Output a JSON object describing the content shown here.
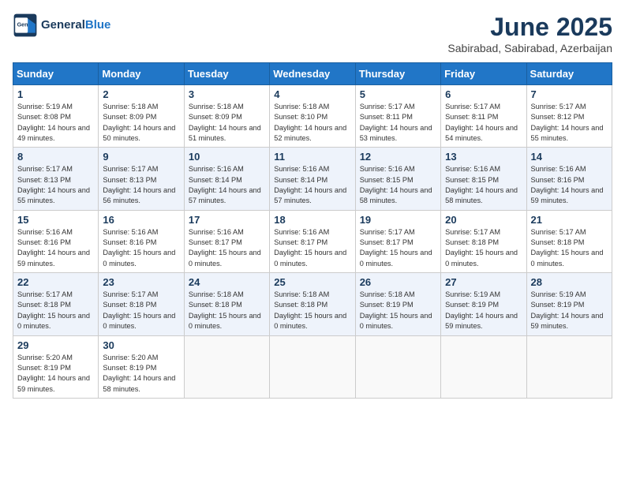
{
  "logo": {
    "line1": "General",
    "line2": "Blue"
  },
  "title": "June 2025",
  "subtitle": "Sabirabad, Sabirabad, Azerbaijan",
  "weekdays": [
    "Sunday",
    "Monday",
    "Tuesday",
    "Wednesday",
    "Thursday",
    "Friday",
    "Saturday"
  ],
  "weeks": [
    [
      {
        "day": "1",
        "sunrise": "Sunrise: 5:19 AM",
        "sunset": "Sunset: 8:08 PM",
        "daylight": "Daylight: 14 hours and 49 minutes."
      },
      {
        "day": "2",
        "sunrise": "Sunrise: 5:18 AM",
        "sunset": "Sunset: 8:09 PM",
        "daylight": "Daylight: 14 hours and 50 minutes."
      },
      {
        "day": "3",
        "sunrise": "Sunrise: 5:18 AM",
        "sunset": "Sunset: 8:09 PM",
        "daylight": "Daylight: 14 hours and 51 minutes."
      },
      {
        "day": "4",
        "sunrise": "Sunrise: 5:18 AM",
        "sunset": "Sunset: 8:10 PM",
        "daylight": "Daylight: 14 hours and 52 minutes."
      },
      {
        "day": "5",
        "sunrise": "Sunrise: 5:17 AM",
        "sunset": "Sunset: 8:11 PM",
        "daylight": "Daylight: 14 hours and 53 minutes."
      },
      {
        "day": "6",
        "sunrise": "Sunrise: 5:17 AM",
        "sunset": "Sunset: 8:11 PM",
        "daylight": "Daylight: 14 hours and 54 minutes."
      },
      {
        "day": "7",
        "sunrise": "Sunrise: 5:17 AM",
        "sunset": "Sunset: 8:12 PM",
        "daylight": "Daylight: 14 hours and 55 minutes."
      }
    ],
    [
      {
        "day": "8",
        "sunrise": "Sunrise: 5:17 AM",
        "sunset": "Sunset: 8:13 PM",
        "daylight": "Daylight: 14 hours and 55 minutes."
      },
      {
        "day": "9",
        "sunrise": "Sunrise: 5:17 AM",
        "sunset": "Sunset: 8:13 PM",
        "daylight": "Daylight: 14 hours and 56 minutes."
      },
      {
        "day": "10",
        "sunrise": "Sunrise: 5:16 AM",
        "sunset": "Sunset: 8:14 PM",
        "daylight": "Daylight: 14 hours and 57 minutes."
      },
      {
        "day": "11",
        "sunrise": "Sunrise: 5:16 AM",
        "sunset": "Sunset: 8:14 PM",
        "daylight": "Daylight: 14 hours and 57 minutes."
      },
      {
        "day": "12",
        "sunrise": "Sunrise: 5:16 AM",
        "sunset": "Sunset: 8:15 PM",
        "daylight": "Daylight: 14 hours and 58 minutes."
      },
      {
        "day": "13",
        "sunrise": "Sunrise: 5:16 AM",
        "sunset": "Sunset: 8:15 PM",
        "daylight": "Daylight: 14 hours and 58 minutes."
      },
      {
        "day": "14",
        "sunrise": "Sunrise: 5:16 AM",
        "sunset": "Sunset: 8:16 PM",
        "daylight": "Daylight: 14 hours and 59 minutes."
      }
    ],
    [
      {
        "day": "15",
        "sunrise": "Sunrise: 5:16 AM",
        "sunset": "Sunset: 8:16 PM",
        "daylight": "Daylight: 14 hours and 59 minutes."
      },
      {
        "day": "16",
        "sunrise": "Sunrise: 5:16 AM",
        "sunset": "Sunset: 8:16 PM",
        "daylight": "Daylight: 15 hours and 0 minutes."
      },
      {
        "day": "17",
        "sunrise": "Sunrise: 5:16 AM",
        "sunset": "Sunset: 8:17 PM",
        "daylight": "Daylight: 15 hours and 0 minutes."
      },
      {
        "day": "18",
        "sunrise": "Sunrise: 5:16 AM",
        "sunset": "Sunset: 8:17 PM",
        "daylight": "Daylight: 15 hours and 0 minutes."
      },
      {
        "day": "19",
        "sunrise": "Sunrise: 5:17 AM",
        "sunset": "Sunset: 8:17 PM",
        "daylight": "Daylight: 15 hours and 0 minutes."
      },
      {
        "day": "20",
        "sunrise": "Sunrise: 5:17 AM",
        "sunset": "Sunset: 8:18 PM",
        "daylight": "Daylight: 15 hours and 0 minutes."
      },
      {
        "day": "21",
        "sunrise": "Sunrise: 5:17 AM",
        "sunset": "Sunset: 8:18 PM",
        "daylight": "Daylight: 15 hours and 0 minutes."
      }
    ],
    [
      {
        "day": "22",
        "sunrise": "Sunrise: 5:17 AM",
        "sunset": "Sunset: 8:18 PM",
        "daylight": "Daylight: 15 hours and 0 minutes."
      },
      {
        "day": "23",
        "sunrise": "Sunrise: 5:17 AM",
        "sunset": "Sunset: 8:18 PM",
        "daylight": "Daylight: 15 hours and 0 minutes."
      },
      {
        "day": "24",
        "sunrise": "Sunrise: 5:18 AM",
        "sunset": "Sunset: 8:18 PM",
        "daylight": "Daylight: 15 hours and 0 minutes."
      },
      {
        "day": "25",
        "sunrise": "Sunrise: 5:18 AM",
        "sunset": "Sunset: 8:18 PM",
        "daylight": "Daylight: 15 hours and 0 minutes."
      },
      {
        "day": "26",
        "sunrise": "Sunrise: 5:18 AM",
        "sunset": "Sunset: 8:19 PM",
        "daylight": "Daylight: 15 hours and 0 minutes."
      },
      {
        "day": "27",
        "sunrise": "Sunrise: 5:19 AM",
        "sunset": "Sunset: 8:19 PM",
        "daylight": "Daylight: 14 hours and 59 minutes."
      },
      {
        "day": "28",
        "sunrise": "Sunrise: 5:19 AM",
        "sunset": "Sunset: 8:19 PM",
        "daylight": "Daylight: 14 hours and 59 minutes."
      }
    ],
    [
      {
        "day": "29",
        "sunrise": "Sunrise: 5:20 AM",
        "sunset": "Sunset: 8:19 PM",
        "daylight": "Daylight: 14 hours and 59 minutes."
      },
      {
        "day": "30",
        "sunrise": "Sunrise: 5:20 AM",
        "sunset": "Sunset: 8:19 PM",
        "daylight": "Daylight: 14 hours and 58 minutes."
      },
      null,
      null,
      null,
      null,
      null
    ]
  ]
}
